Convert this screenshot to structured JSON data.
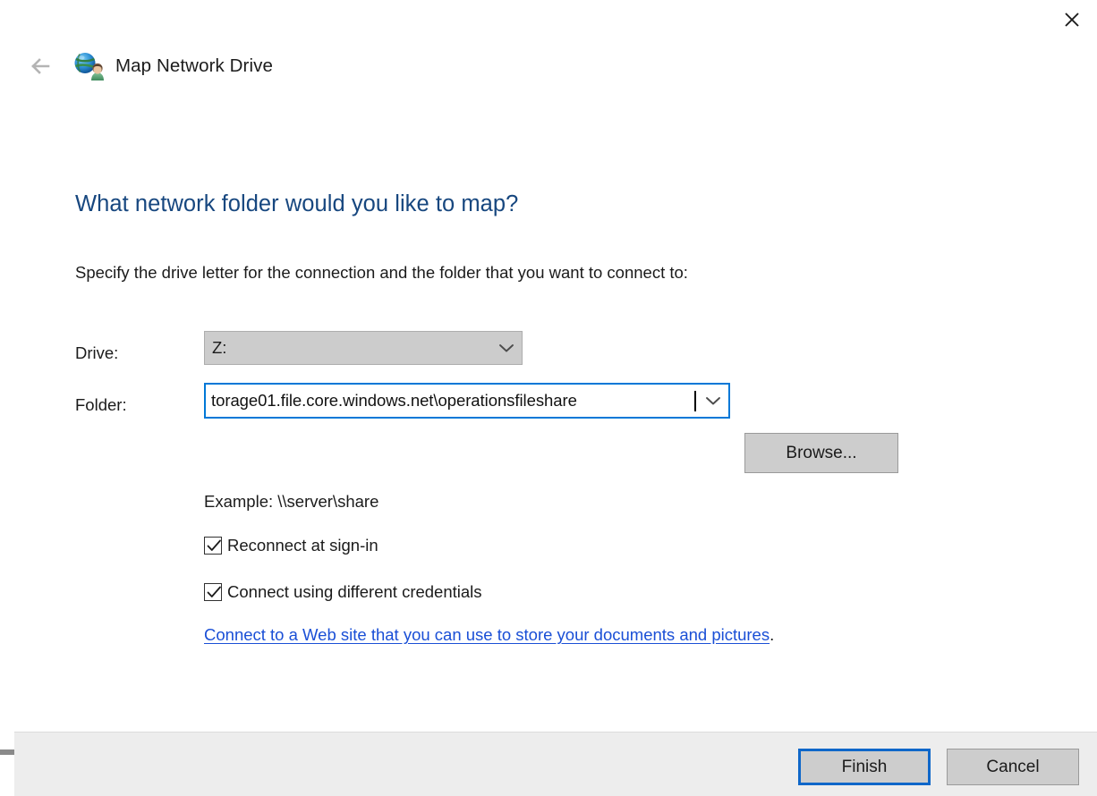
{
  "window": {
    "title": "Map Network Drive",
    "icon": "map-network-drive-icon",
    "close_label": "✕",
    "back_label": "←"
  },
  "wizard": {
    "heading": "What network folder would you like to map?",
    "subheading": "Specify the drive letter for the connection and the folder that you want to connect to:"
  },
  "form": {
    "drive": {
      "label": "Drive:",
      "value": "Z:",
      "caret_icon": "chevron-down-icon",
      "enabled": false
    },
    "folder": {
      "label": "Folder:",
      "value": "torage01.file.core.windows.net\\operationsfileshare",
      "placeholder": "",
      "caret_icon": "chevron-down-icon",
      "focused": true
    },
    "browse_label": "Browse...",
    "example": "Example: \\\\server\\share",
    "checkboxes": [
      {
        "label": "Reconnect at sign-in",
        "checked": true
      },
      {
        "label": "Connect using different credentials",
        "checked": true
      }
    ],
    "link": {
      "text": "Connect to a Web site that you can use to store your documents and pictures",
      "trailing": "."
    }
  },
  "footer": {
    "finish_label": "Finish",
    "cancel_label": "Cancel"
  },
  "colors": {
    "heading_blue": "#17477f",
    "link_blue": "#1a4fd6",
    "focus_blue": "#0078d7",
    "default_button_border": "#0f67c9",
    "control_gray": "#cdcdcd",
    "footer_gray": "#ededed"
  }
}
